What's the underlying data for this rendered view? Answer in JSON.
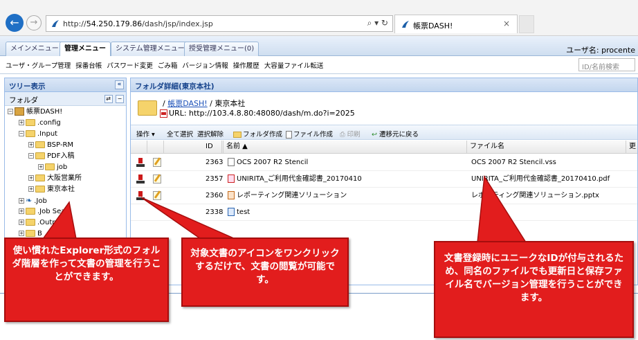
{
  "browser": {
    "url_prefix": "http://",
    "url_host": "54.250.179.86",
    "url_path": "/dash/jsp/index.jsp",
    "url_tools": "⌕ ▾ ↻",
    "tab_title": "帳票DASH!",
    "tab_close": "×"
  },
  "menu": {
    "tabs": [
      "メインメニュー",
      "管理メニュー",
      "システム管理メニュー",
      "授受管理メニュー(0)"
    ],
    "active_index": 1,
    "user_label": "ユーザ名: procente"
  },
  "submenu": {
    "items": [
      "ユーザ・グループ管理",
      "採番台帳",
      "パスワード変更",
      "ごみ箱",
      "バージョン情報",
      "操作履歴",
      "大容量ファイル転送"
    ],
    "search_placeholder": "ID/名前検索"
  },
  "tree": {
    "header": "ツリー表示",
    "collapse_glyph": "«",
    "subheader": "フォルダ",
    "subbuttons": [
      "⇄",
      "−"
    ],
    "nodes": [
      {
        "label": "帳票DASH!",
        "depth": 0,
        "toggle": "−",
        "icon": "root"
      },
      {
        "label": ".config",
        "depth": 1,
        "toggle": "+",
        "icon": "folder"
      },
      {
        "label": ".Input",
        "depth": 1,
        "toggle": "−",
        "icon": "folder"
      },
      {
        "label": "BSP-RM",
        "depth": 2,
        "toggle": "+",
        "icon": "folder"
      },
      {
        "label": "PDF入稿",
        "depth": 2,
        "toggle": "−",
        "icon": "folder"
      },
      {
        "label": "job",
        "depth": 3,
        "toggle": "+",
        "icon": "folder"
      },
      {
        "label": "大阪営業所",
        "depth": 2,
        "toggle": "+",
        "icon": "folder"
      },
      {
        "label": "東京本社",
        "depth": 2,
        "toggle": "+",
        "icon": "folder"
      },
      {
        "label": ".Job",
        "depth": 1,
        "toggle": "+",
        "icon": "bird"
      },
      {
        "label": ".Job Sea",
        "depth": 1,
        "toggle": "+",
        "icon": "folder"
      },
      {
        "label": ".Outp",
        "depth": 1,
        "toggle": "+",
        "icon": "folder"
      },
      {
        "label": "B",
        "depth": 1,
        "toggle": "+",
        "icon": "folder"
      }
    ]
  },
  "detail": {
    "header": "フォルダ詳細(東京本社)",
    "path_sep1": "/ ",
    "path_link": "帳票DASH!",
    "path_rest": " / 東京本社",
    "url_text": "URL:  http://103.4.8.80:48080/dash/m.do?i=2025",
    "toolbar": {
      "operation": "操作 ▾",
      "select_all": "全て選択",
      "deselect": "選択解除",
      "new_folder": "フォルダ作成",
      "new_file": "ファイル作成",
      "print": "印刷",
      "back": "遷移元に戻る"
    },
    "columns": [
      "ID",
      "名前 ▲",
      "ファイル名",
      "更"
    ],
    "rows": [
      {
        "id": "2363",
        "name": "OCS 2007 R2 Stencil",
        "file": "OCS 2007 R2 Stencil.vss",
        "icon": "doc"
      },
      {
        "id": "2357",
        "name": "UNIRITA_ご利用代金確認書_20170410",
        "file": "UNIRITA_ご利用代金確認書_20170410.pdf",
        "icon": "pdf"
      },
      {
        "id": "2360",
        "name": "レポーティング関連ソリューション",
        "file": "レポーティング関連ソリューション.pptx",
        "icon": "ppt"
      },
      {
        "id": "2338",
        "name": "test",
        "file": "",
        "icon": "url"
      }
    ]
  },
  "callouts": {
    "left": "使い慣れたExplorer形式のフォルダ階層を作って文書の管理を行うことができます。",
    "middle": "対象文書のアイコンをワンクリックするだけで、文書の閲覧が可能です。",
    "right": "文書登録時にユニークなIDが付与されるため、同名のファイルでも更新日と保存ファイル名でバージョン管理を行うことができます。"
  },
  "colors": {
    "callout_red": "#e21d1d",
    "panel_header": "#15428b",
    "link_blue": "#1a4fb8"
  }
}
